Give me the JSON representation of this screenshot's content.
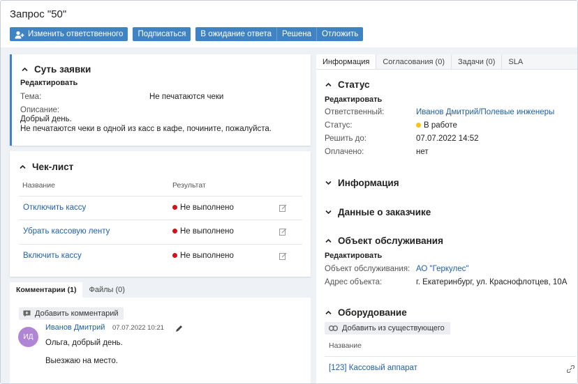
{
  "page": {
    "title": "Запрос \"50\""
  },
  "toolbar": {
    "change_assignee": "Изменить ответственного",
    "subscribe": "Подписаться",
    "awaiting_reply": "В ожидание ответа",
    "resolved": "Решена",
    "postpone": "Отложить"
  },
  "essence": {
    "header": "Суть заявки",
    "edit": "Редактировать",
    "subject_label": "Тема:",
    "subject_value": "Не печатаются чеки",
    "description_label": "Описание:",
    "description_line1": "Добрый день.",
    "description_line2": "Не печатаются чеки в одной из касс в кафе, почините, пожалуйста."
  },
  "checklist": {
    "header": "Чек-лист",
    "col_name": "Название",
    "col_result": "Результат",
    "items": [
      {
        "name": "Отключить кассу",
        "result": "Не выполнено"
      },
      {
        "name": "Убрать кассовую ленту",
        "result": "Не выполнено"
      },
      {
        "name": "Включить кассу",
        "result": "Не выполнено"
      }
    ]
  },
  "comments": {
    "tab_comments": "Комментарии (1)",
    "tab_files": "Файлы (0)",
    "add_comment": "Добавить комментарий",
    "author": "Иванов Дмитрий",
    "avatar_initials": "ИД",
    "date": "07.07.2022 10:21",
    "line1": "Ольга, добрый день.",
    "line2": "Выезжаю на место."
  },
  "right_tabs": [
    "Информация",
    "Согласования (0)",
    "Задачи (0)",
    "SLA"
  ],
  "status": {
    "header": "Статус",
    "edit": "Редактировать",
    "assignee_label": "Ответственный:",
    "assignee_value": "Иванов Дмитрий/Полевые инженеры",
    "status_label": "Статус:",
    "status_value": "В работе",
    "due_label": "Решить до:",
    "due_value": "07.07.2022 14:52",
    "paid_label": "Оплачено:",
    "paid_value": "нет"
  },
  "info_section": {
    "header": "Информация"
  },
  "customer_section": {
    "header": "Данные о заказчике"
  },
  "service_object": {
    "header": "Объект обслуживания",
    "edit": "Редактировать",
    "object_label": "Объект обслуживания:",
    "object_value": "АО \"Геркулес\"",
    "address_label": "Адрес объекта:",
    "address_value": "г. Екатеринбург, ул. Краснофлотцев, 10А"
  },
  "equipment": {
    "header": "Оборудование",
    "add_existing": "Добавить из существующего",
    "col_name": "Название",
    "item": "[123] Кассовый аппарат"
  },
  "colors": {
    "accent": "#3f83c3",
    "link": "#1f5fa8",
    "status_in_progress": "#f5c518",
    "not_done": "#d0121b",
    "avatar": "#b085d6"
  }
}
